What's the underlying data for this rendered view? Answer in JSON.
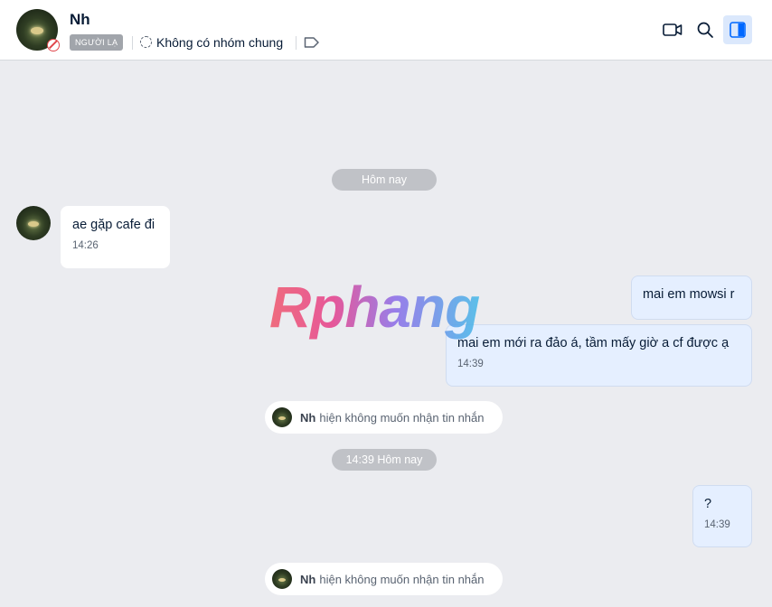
{
  "header": {
    "contact_name": "Nh",
    "stranger_label": "NGƯỜI LẠ",
    "mutual_groups": "Không có nhóm chung"
  },
  "icons": {
    "video": "video-camera-icon",
    "search": "search-icon",
    "panel": "sidebar-panel-icon",
    "tag": "tag-icon",
    "groups": "group-icon"
  },
  "chat": {
    "date_divider_1": "Hôm nay",
    "date_divider_2": "14:39 Hôm nay",
    "messages": [
      {
        "direction": "in",
        "text": "ae gặp cafe đi",
        "time": "14:26"
      },
      {
        "direction": "out",
        "text": "mai em mowsi r",
        "time": ""
      },
      {
        "direction": "out",
        "text": "mai em mới ra đảo á, tầm mấy giờ a cf được ạ",
        "time": "14:39"
      },
      {
        "direction": "out",
        "text": "?",
        "time": "14:39"
      }
    ],
    "notices": [
      {
        "name": "Nh",
        "text": "hiện không muốn nhận tin nhắn"
      },
      {
        "name": "Nh",
        "text": "hiện không muốn nhận tin nhắn"
      }
    ]
  },
  "watermark": "Rphang",
  "colors": {
    "accent": "#0068ff",
    "background": "#ebecf0",
    "outgoing_bubble": "#e5efff",
    "blocked_badge": "#e0454b"
  }
}
